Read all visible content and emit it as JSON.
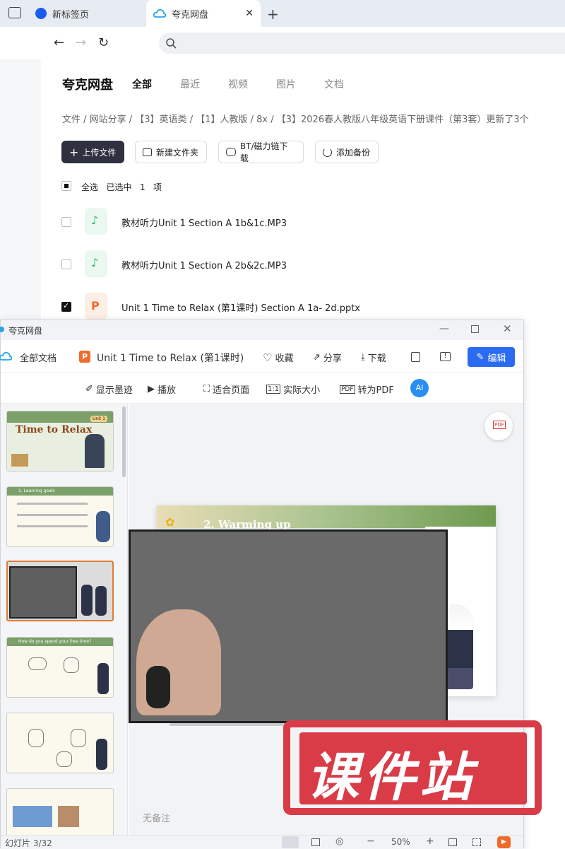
{
  "browser": {
    "tabs": [
      {
        "label": "新标签页"
      },
      {
        "label": "夸克网盘"
      }
    ],
    "close_glyph": "✕",
    "newtab_glyph": "+",
    "nav": {
      "back": "←",
      "forward": "→",
      "reload": "↻"
    }
  },
  "drive": {
    "brand": "夸克网盘",
    "tabs": [
      "全部",
      "最近",
      "视频",
      "图片",
      "文档"
    ],
    "breadcrumb": "文件 / 网站分享 / 【3】英语类 / 【1】人教版 / 8x / 【3】2026春人教版八年级英语下册课件（第3套）更新了3个",
    "buttons": {
      "upload": "上传文件",
      "new_folder": "新建文件夹",
      "bt": "BT/磁力链下载",
      "backup": "添加备份"
    },
    "select_all": "全选",
    "selected": "已选中",
    "selected_count": "1",
    "selected_unit": "项",
    "files": [
      {
        "name": "教材听力Unit 1 Section A 1b&1c.MP3",
        "checked": false,
        "type": "audio"
      },
      {
        "name": "教材听力Unit 1 Section A 2b&2c.MP3",
        "checked": false,
        "type": "audio"
      },
      {
        "name": "Unit 1 Time to Relax (第1课时) Section A 1a- 2d.pptx",
        "checked": true,
        "type": "ppt"
      }
    ]
  },
  "viewer": {
    "window_title": "夸克网盘",
    "toolbar": {
      "all_docs": "全部文档",
      "doc_name": "Unit 1 Time to Relax (第1课时) S",
      "favorite": "收藏",
      "share": "分享",
      "download": "下载",
      "edit": "编辑"
    },
    "toolbar2": {
      "ink": "显示墨迹",
      "play": "播放",
      "fit": "适合页面",
      "actual": "实际大小",
      "to_pdf": "转为PDF"
    },
    "slide_texts": {
      "title": "Time to Relax",
      "unit": "Unit 1",
      "warm": "2. Warming up",
      "learning": "1. Learning goals",
      "question": "How do you spend your free time?"
    },
    "notes": "无备注",
    "status": {
      "slide": "幻灯片 3/32",
      "zoom": "50%"
    },
    "colors": {
      "accent": "#2a6bf2",
      "selected_thumb": "#e07b39",
      "watermark": "#d93b47"
    }
  },
  "watermark": {
    "text": "课件站"
  }
}
